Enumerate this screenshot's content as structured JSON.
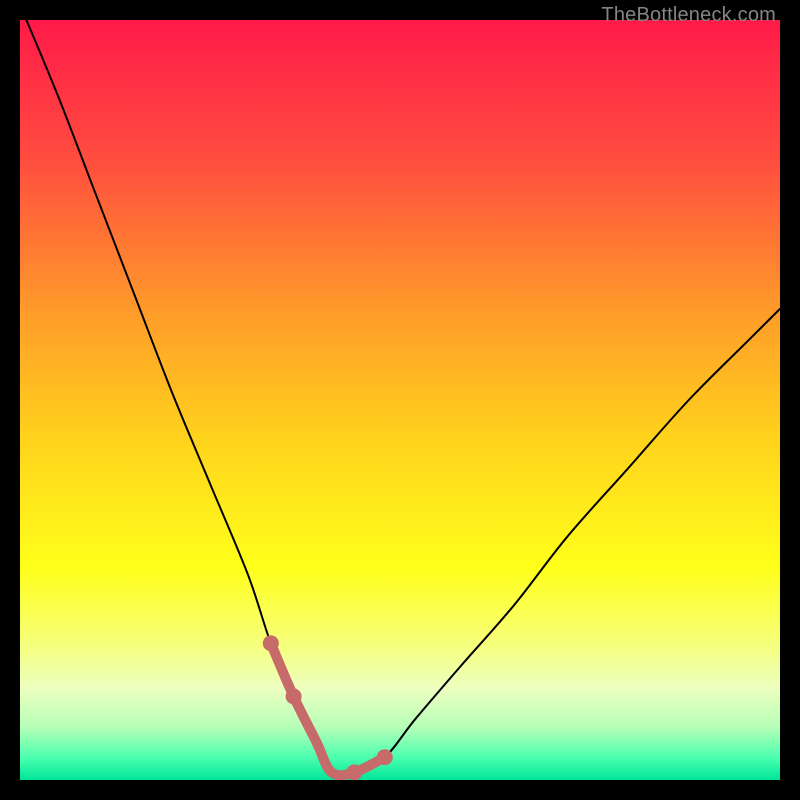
{
  "watermark": "TheBottleneck.com",
  "chart_data": {
    "type": "line",
    "title": "",
    "xlabel": "",
    "ylabel": "",
    "xlim": [
      0,
      100
    ],
    "ylim": [
      0,
      100
    ],
    "background": {
      "type": "vertical-gradient",
      "stops": [
        {
          "offset": 0.0,
          "color": "#ff1a49"
        },
        {
          "offset": 0.18,
          "color": "#ff4b3f"
        },
        {
          "offset": 0.38,
          "color": "#ff9a2a"
        },
        {
          "offset": 0.55,
          "color": "#ffd21c"
        },
        {
          "offset": 0.72,
          "color": "#ffff1a"
        },
        {
          "offset": 0.82,
          "color": "#f6ff7a"
        },
        {
          "offset": 0.88,
          "color": "#ecffc0"
        },
        {
          "offset": 0.93,
          "color": "#b7ffb7"
        },
        {
          "offset": 0.97,
          "color": "#4dffb0"
        },
        {
          "offset": 1.0,
          "color": "#00e599"
        }
      ]
    },
    "series": [
      {
        "name": "bottleneck-curve",
        "stroke": "#000000",
        "x": [
          0,
          5,
          10,
          15,
          20,
          25,
          30,
          33,
          36,
          39,
          41,
          44,
          48,
          52,
          58,
          65,
          72,
          80,
          88,
          96,
          100
        ],
        "y": [
          102,
          90,
          77,
          64,
          51,
          39,
          27,
          18,
          11,
          5,
          1,
          1,
          3,
          8,
          15,
          23,
          32,
          41,
          50,
          58,
          62
        ]
      },
      {
        "name": "highlight-band",
        "stroke": "#c76a6a",
        "stroke_width": 10,
        "x": [
          33,
          36,
          39,
          41,
          44,
          48
        ],
        "y": [
          18,
          11,
          5,
          1,
          1,
          3
        ]
      }
    ],
    "markers": [
      {
        "series": "highlight-band",
        "x": 33,
        "y": 18,
        "r": 5
      },
      {
        "series": "highlight-band",
        "x": 36,
        "y": 11,
        "r": 5
      },
      {
        "series": "highlight-band",
        "x": 44,
        "y": 1,
        "r": 5
      },
      {
        "series": "highlight-band",
        "x": 48,
        "y": 3,
        "r": 5
      }
    ]
  }
}
